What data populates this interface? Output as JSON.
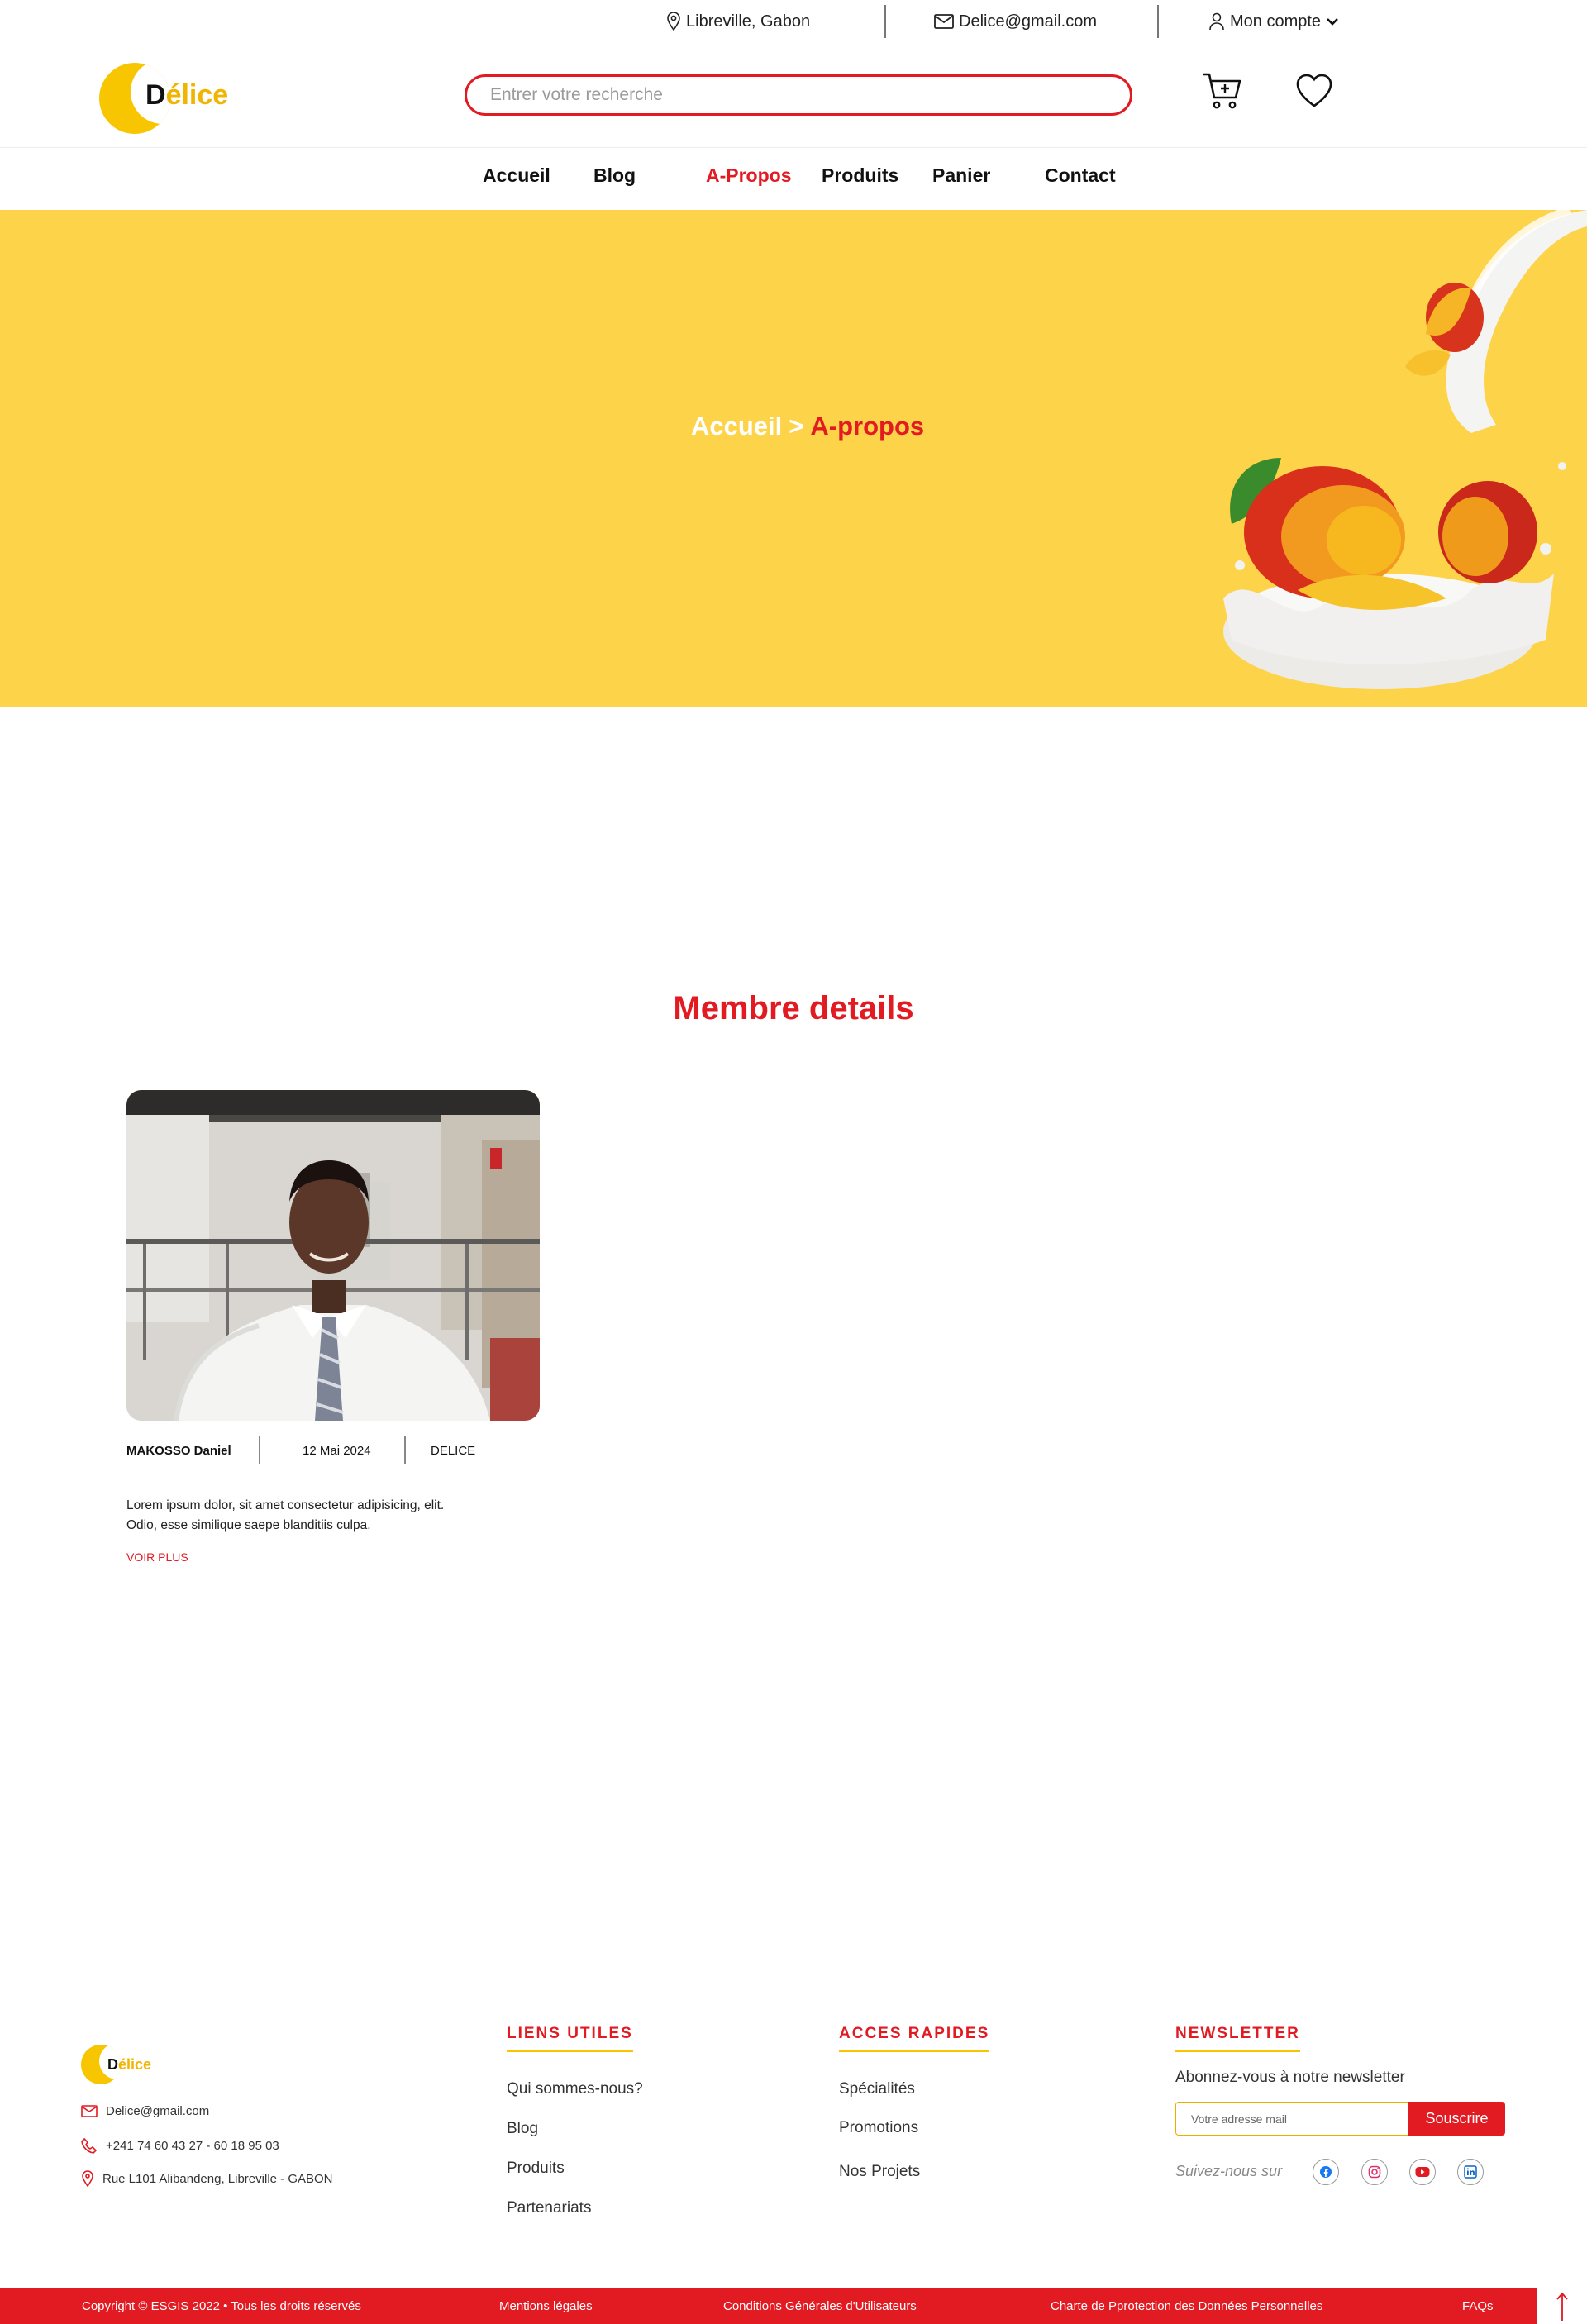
{
  "topbar": {
    "location": "Libreville, Gabon",
    "email": "Delice@gmail.com",
    "account": "Mon compte"
  },
  "header": {
    "logo_first": "D",
    "logo_rest": "élice",
    "search_placeholder": "Entrer votre recherche"
  },
  "nav": {
    "items": [
      {
        "label": "Accueil"
      },
      {
        "label": "Blog"
      },
      {
        "label": "A-Propos"
      },
      {
        "label": "Produits"
      },
      {
        "label": "Panier"
      },
      {
        "label": "Contact"
      }
    ],
    "active_index": 2
  },
  "hero": {
    "crumb_home": "Accueil",
    "crumb_sep": ">",
    "crumb_current": "A-propos"
  },
  "section": {
    "title": "Membre details"
  },
  "member": {
    "name": "MAKOSSO Daniel",
    "date": "12 Mai 2024",
    "company": "DELICE",
    "excerpt": "Lorem ipsum dolor, sit amet consectetur adipisicing, elit. Odio, esse similique saepe blanditiis culpa.",
    "more": "VOIR PLUS"
  },
  "footer": {
    "logo_first": "D",
    "logo_rest": "élice",
    "email": "Delice@gmail.com",
    "phone": "+241 74 60 43 27 - 60 18 95 03",
    "address": "Rue L101 Alibandeng, Libreville - GABON",
    "links_title": "LIENS UTILES",
    "links": [
      "Qui sommes-nous?",
      "Blog",
      "Produits",
      "Partenariats"
    ],
    "quick_title": "ACCES RAPIDES",
    "quick": [
      "Spécialités",
      "Promotions",
      "Nos Projets"
    ],
    "newsletter_title": "NEWSLETTER",
    "newsletter_text": "Abonnez-vous à notre newsletter",
    "newsletter_placeholder": "Votre adresse mail",
    "newsletter_button": "Souscrire",
    "follow": "Suivez-nous sur"
  },
  "bottom": {
    "copyright": "Copyright © ESGIS 2022 • Tous les droits réservés",
    "legal": "Mentions légales",
    "cgu": "Conditions Générales d'Utilisateurs",
    "charter": "Charte de Pprotection des Données Personnelles",
    "faq": "FAQs"
  },
  "colors": {
    "brand_red": "#e21a22",
    "brand_yellow": "#fdd34a",
    "logo_yellow": "#f7c600"
  }
}
